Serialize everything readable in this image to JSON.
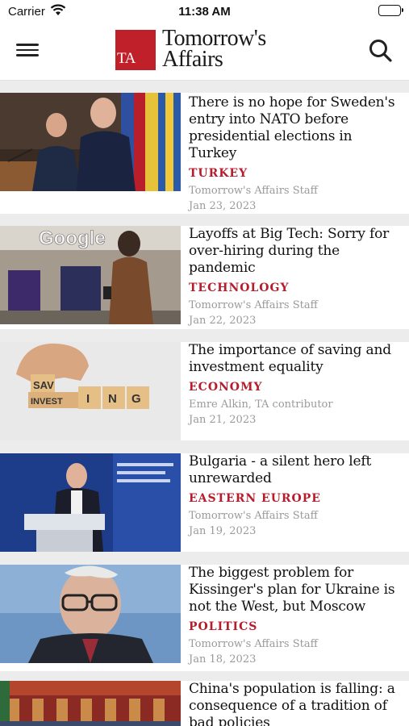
{
  "status_bar": {
    "carrier": "Carrier",
    "time": "11:38 AM"
  },
  "header": {
    "logo_initials": "TA",
    "logo_line1": "Tomorrow's",
    "logo_line2": "Affairs"
  },
  "articles": [
    {
      "headline": "There is no hope for Sweden's entry into NATO before presidential elections in Turkey",
      "category": "TURKEY",
      "author": "Tomorrow's Affairs Staff",
      "date": "Jan 23, 2023"
    },
    {
      "headline": "Layoffs at Big Tech: Sorry for over-hiring during the pandemic",
      "category": "TECHNOLOGY",
      "author": "Tomorrow's Affairs Staff",
      "date": "Jan 22, 2023",
      "image_text": "Google"
    },
    {
      "headline": "The importance of saving and investment equality",
      "category": "ECONOMY",
      "author": "Emre Alkin, TA contributor",
      "date": "Jan 21, 2023",
      "image_text": [
        "SAV",
        "INVEST",
        "I",
        "N",
        "G"
      ]
    },
    {
      "headline": "Bulgaria - a silent hero left unrewarded",
      "category": "EASTERN EUROPE",
      "author": "Tomorrow's Affairs Staff",
      "date": "Jan 19, 2023"
    },
    {
      "headline": "The biggest problem for Kissinger's plan for Ukraine is not the West, but Moscow",
      "category": "POLITICS",
      "author": "Tomorrow's Affairs Staff",
      "date": "Jan 18, 2023"
    },
    {
      "headline": "China's population is falling: a consequence of a tradition of bad policies",
      "category": "",
      "author": "",
      "date": ""
    }
  ],
  "colors": {
    "brand_red": "#c0202a",
    "category_red": "#b71c2c",
    "meta_gray": "#9a9a9a"
  },
  "icons": {
    "menu": "hamburger-icon",
    "search": "search-icon",
    "wifi": "wifi-icon",
    "battery": "battery-icon"
  }
}
